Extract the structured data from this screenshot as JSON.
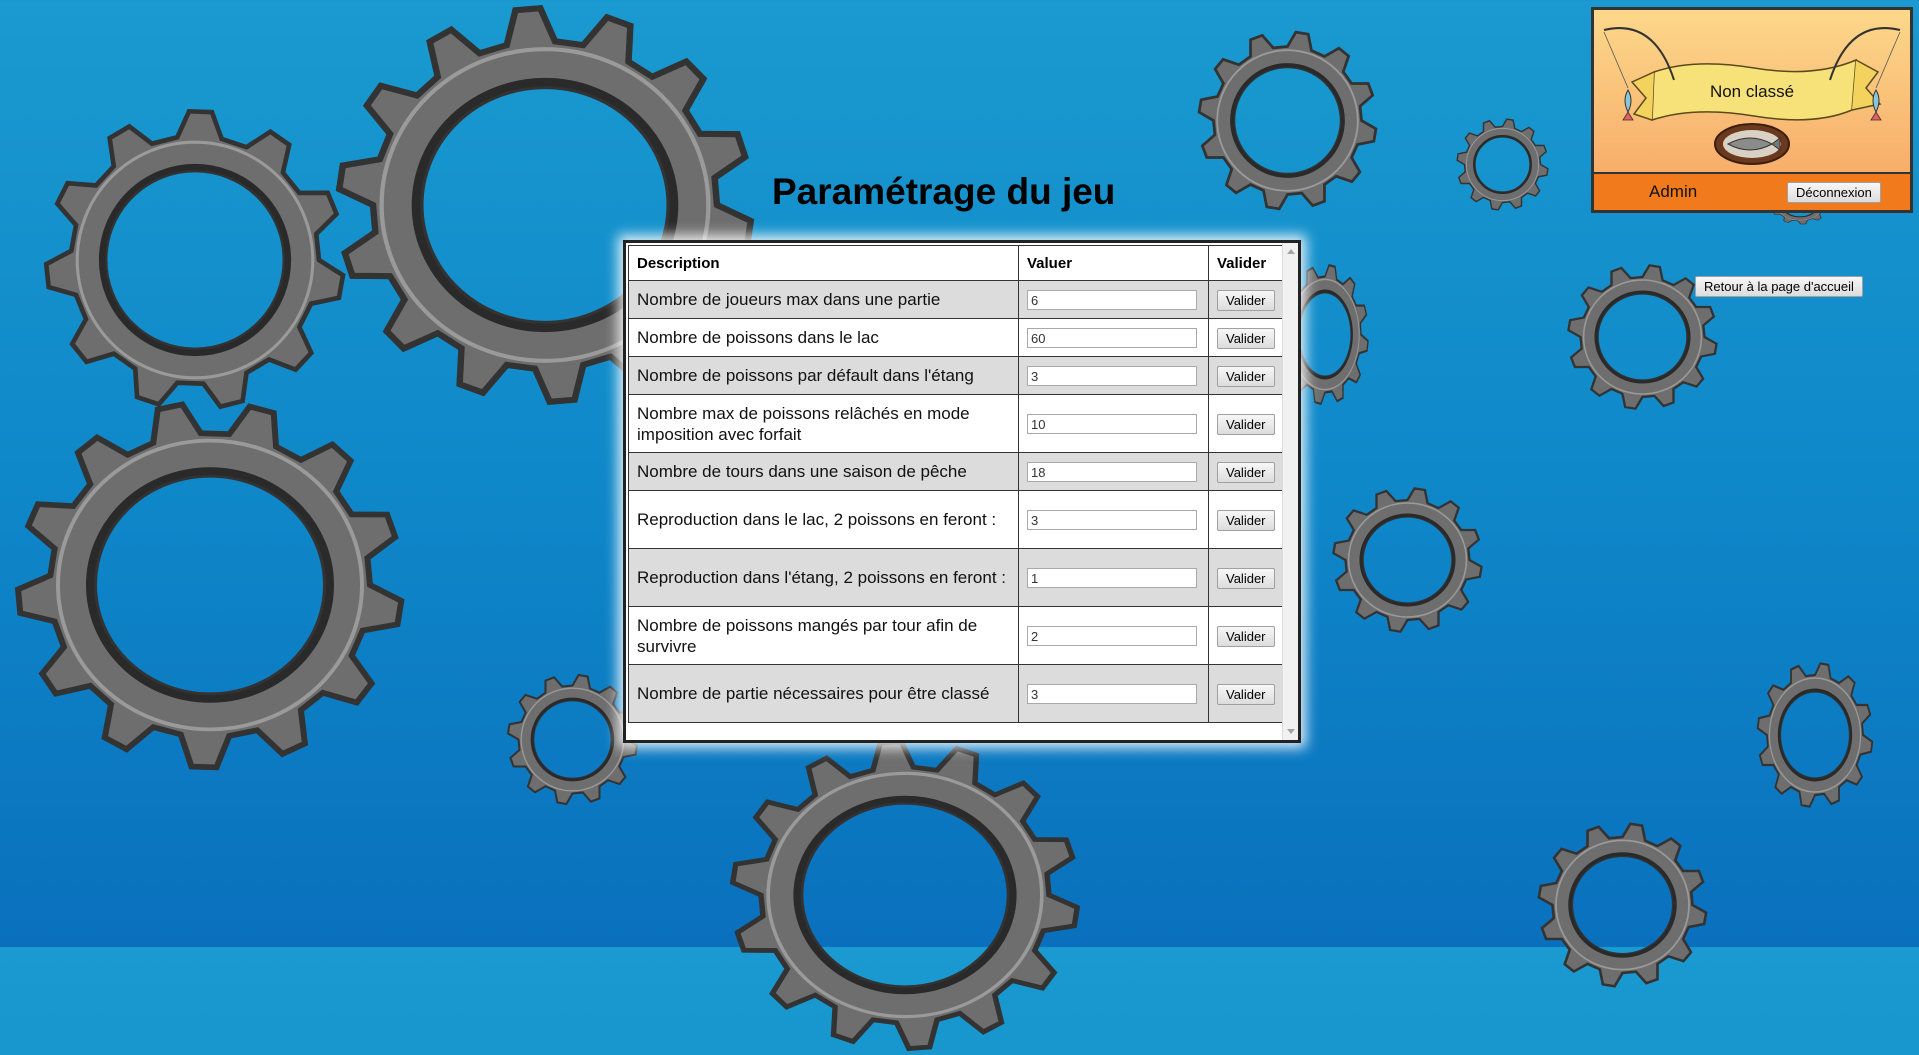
{
  "page": {
    "title": "Paramétrage du jeu"
  },
  "user_panel": {
    "rank": "Non classé",
    "username": "Admin",
    "logout_label": "Déconnexion"
  },
  "home_button_label": "Retour à la page d'accueil",
  "table": {
    "headers": {
      "description": "Description",
      "value": "Valuer",
      "action": "Valider"
    },
    "button_label": "Valider",
    "rows": [
      {
        "description": "Nombre de joueurs max dans une partie",
        "value": "6"
      },
      {
        "description": "Nombre de poissons dans le lac",
        "value": "60"
      },
      {
        "description": "Nombre de poissons par défault dans l'étang",
        "value": "3"
      },
      {
        "description": "Nombre max de poissons relâchés en mode imposition avec forfait",
        "value": "10"
      },
      {
        "description": "Nombre de tours dans une saison de pêche",
        "value": "18"
      },
      {
        "description": "Reproduction dans le lac, 2 poissons en feront :",
        "value": "3"
      },
      {
        "description": "Reproduction dans l'étang, 2 poissons en feront :",
        "value": "1"
      },
      {
        "description": "Nombre de poissons mangés par tour afin de survivre",
        "value": "2"
      },
      {
        "description": "Nombre de partie nécessaires pour être classé",
        "value": "3"
      }
    ]
  },
  "colors": {
    "background_top": "#1a9ad0",
    "background_bottom": "#0a70bd",
    "gear": "#6e6e6e",
    "user_bar": "#f07a1c"
  }
}
